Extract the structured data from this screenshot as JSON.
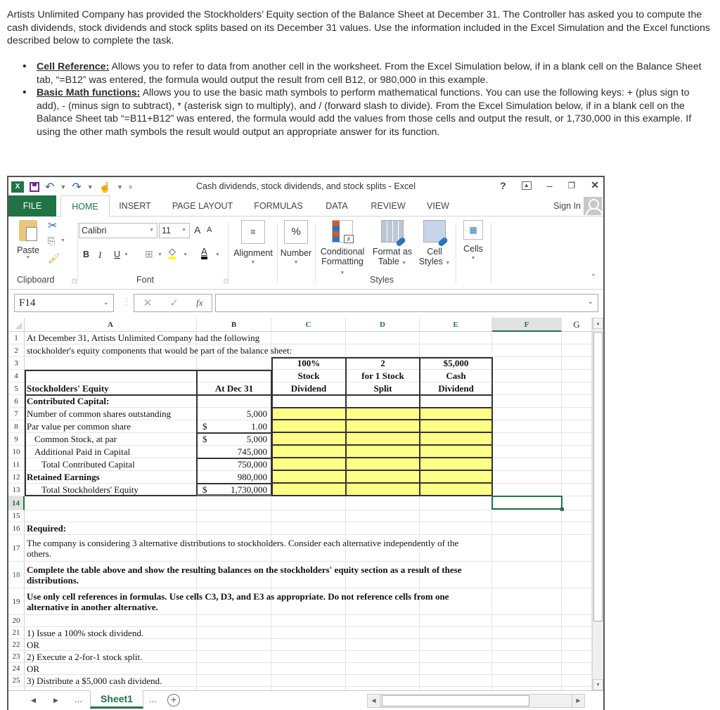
{
  "intro": {
    "paragraph": "Artists Unlimited Company has provided the Stockholders’ Equity section of the Balance Sheet at December 31.  The Controller has asked you to compute the cash dividends, stock dividends and stock splits based on its December 31 values.  Use the information included in the Excel Simulation and the Excel functions described below to complete the task.",
    "bullets": [
      {
        "term": "Cell Reference:",
        "text": " Allows you to refer to data from another cell in the worksheet.  From the Excel Simulation below, if in a blank cell on the Balance Sheet tab, “=B12” was entered, the formula would output the result from cell B12, or 980,000 in this example."
      },
      {
        "term": "Basic Math functions:",
        "text": " Allows you to use the basic math symbols to perform mathematical functions.  You can use the following keys:  + (plus sign to add), - (minus sign to subtract), * (asterisk sign to multiply), and / (forward slash to divide).  From the Excel Simulation below, if in a blank cell on the Balance Sheet tab “=B11+B12” was entered, the formula would add the values from those cells and output the result, or 1,730,000 in this example.  If using the other math symbols the result would output an appropriate answer for its function."
      }
    ]
  },
  "excel": {
    "title": "Cash dividends, stock dividends, and stock splits - Excel",
    "window_controls": {
      "help": "?",
      "restore_ribbon": "⇞",
      "minimize": "–",
      "maximize": "🗗",
      "close": "✕"
    },
    "tabs": [
      "FILE",
      "HOME",
      "INSERT",
      "PAGE LAYOUT",
      "FORMULAS",
      "DATA",
      "REVIEW",
      "VIEW"
    ],
    "sign_in": "Sign In",
    "ribbon": {
      "clipboard": {
        "paste": "Paste",
        "label": "Clipboard"
      },
      "font": {
        "name": "Calibri",
        "size": "11",
        "bold": "B",
        "italic": "I",
        "underline": "U",
        "grow": "A",
        "shrink": "A",
        "font_color": "A",
        "label": "Font"
      },
      "alignment": {
        "label": "Alignment",
        "icon": "≡"
      },
      "number": {
        "label": "Number",
        "icon": "%"
      },
      "styles": {
        "conditional": [
          "Conditional",
          "Formatting"
        ],
        "format_table": [
          "Format as",
          "Table"
        ],
        "cell_styles": [
          "Cell",
          "Styles"
        ],
        "label": "Styles"
      },
      "cells": {
        "label": "Cells"
      }
    },
    "name_box": "F14",
    "formula_value": "",
    "columns": [
      "A",
      "B",
      "C",
      "D",
      "E",
      "F",
      "G"
    ],
    "selected_cell": "F14",
    "rows": {
      "r1": "At December 31,  Artists Unlimited Company had the following",
      "r2": "stockholder's equity components that would be part of the balance sheet:",
      "headers": {
        "b": "At Dec 31",
        "c": [
          "100%",
          "Stock",
          "Dividend"
        ],
        "d": [
          "2",
          "for 1 Stock",
          "Split"
        ],
        "e": [
          "$5,000",
          "Cash",
          "Dividend"
        ]
      },
      "r5": "Stockholders' Equity",
      "r6": "Contributed Capital:",
      "items": [
        {
          "row": 7,
          "label": "Number of common shares outstanding",
          "dollar": "",
          "value": "5,000",
          "indent": 0,
          "bold": false
        },
        {
          "row": 8,
          "label": "Par value per common share",
          "dollar": "$",
          "value": "1.00",
          "indent": 0,
          "bold": false
        },
        {
          "row": 9,
          "label": "Common Stock, at par",
          "dollar": "$",
          "value": "5,000",
          "indent": 1,
          "bold": false
        },
        {
          "row": 10,
          "label": "Additional Paid in Capital",
          "dollar": "",
          "value": "745,000",
          "indent": 1,
          "bold": false
        },
        {
          "row": 11,
          "label": "Total Contributed Capital",
          "dollar": "",
          "value": "750,000",
          "indent": 2,
          "bold": false
        },
        {
          "row": 12,
          "label": "Retained Earnings",
          "dollar": "",
          "value": "980,000",
          "indent": 0,
          "bold": true
        },
        {
          "row": 13,
          "label": "Total Stockholders' Equity",
          "dollar": "$",
          "value": "1,730,000",
          "indent": 2,
          "bold": false
        }
      ],
      "r16": "Required:",
      "r17": "The company is considering 3 alternative distributions to stockholders.  Consider each alternative independently of the others.",
      "r18": "Complete the table above and show the resulting balances on the stockholders' equity section as a result of these distributions.",
      "r19": "Use only cell references in formulas.  Use cells C3, D3, and E3 as appropriate.  Do not reference cells from one alternative in another alternative.",
      "r21": "1) Issue a 100% stock dividend.",
      "r22": "OR",
      "r23": "2) Execute a 2-for-1 stock split.",
      "r24": "OR",
      "r25": "3) Distribute a $5,000 cash dividend."
    },
    "sheet_tab": "Sheet1",
    "sheet_nav": {
      "prev": "◀",
      "next": "▶",
      "more": "...",
      "add": "+"
    }
  }
}
